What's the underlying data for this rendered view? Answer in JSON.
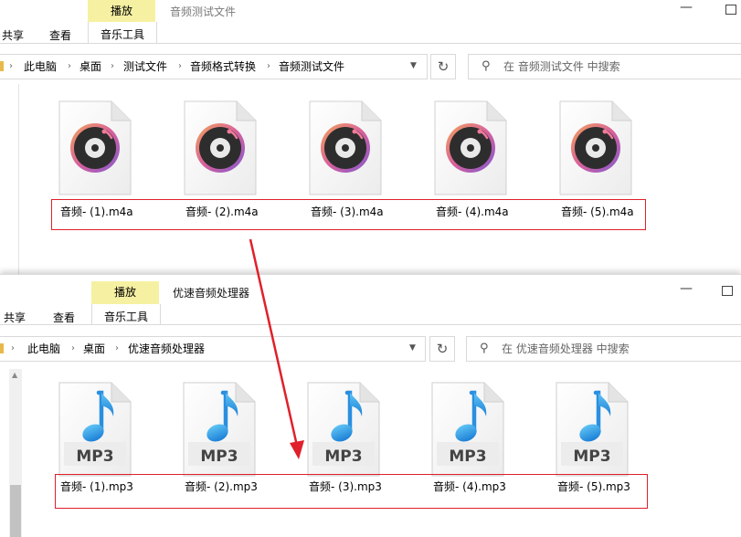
{
  "windows": [
    {
      "title": "音频测试文件",
      "ribbon": {
        "context_tab": "播放",
        "tabs": [
          "共享",
          "查看",
          "音乐工具"
        ]
      },
      "breadcrumbs": [
        "此电脑",
        "桌面",
        "测试文件",
        "音频格式转换",
        "音频测试文件"
      ],
      "search_placeholder": "在 音频测试文件 中搜索",
      "files": [
        {
          "name": "音频- (1).m4a",
          "icon": "vinyl-record-icon"
        },
        {
          "name": "音频- (2).m4a",
          "icon": "vinyl-record-icon"
        },
        {
          "name": "音频- (3).m4a",
          "icon": "vinyl-record-icon"
        },
        {
          "name": "音频- (4).m4a",
          "icon": "vinyl-record-icon"
        },
        {
          "name": "音频- (5).m4a",
          "icon": "vinyl-record-icon"
        }
      ]
    },
    {
      "title": "优速音频处理器",
      "ribbon": {
        "context_tab": "播放",
        "tabs": [
          "共享",
          "查看",
          "音乐工具"
        ]
      },
      "breadcrumbs": [
        "此电脑",
        "桌面",
        "优速音频处理器"
      ],
      "search_placeholder": "在 优速音频处理器 中搜索",
      "file_badge": "MP3",
      "files": [
        {
          "name": "音频- (1).mp3",
          "icon": "mp3-note-icon"
        },
        {
          "name": "音频- (2).mp3",
          "icon": "mp3-note-icon"
        },
        {
          "name": "音频- (3).mp3",
          "icon": "mp3-note-icon"
        },
        {
          "name": "音频- (4).mp3",
          "icon": "mp3-note-icon"
        },
        {
          "name": "音频- (5).mp3",
          "icon": "mp3-note-icon"
        }
      ]
    }
  ],
  "colors": {
    "highlight_box": "#e0202a",
    "arrow": "#e0202a",
    "context_tab": "#f6f1a2"
  }
}
